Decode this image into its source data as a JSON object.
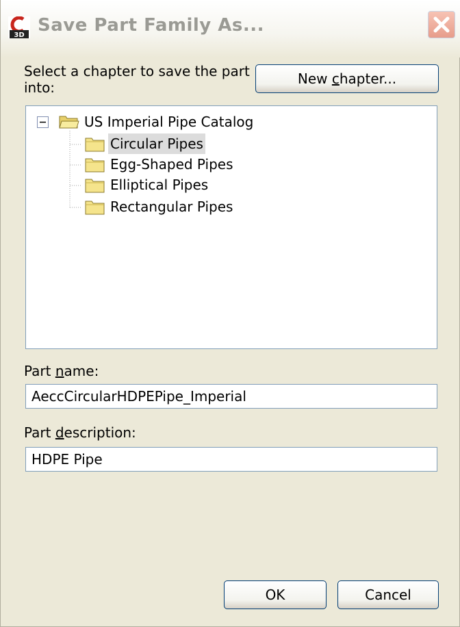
{
  "window": {
    "title": "Save Part Family As..."
  },
  "chapter_section": {
    "prompt": "Select a chapter to save the part into:",
    "new_chapter_button": {
      "before": "New ",
      "mnemonic": "c",
      "after": "hapter..."
    }
  },
  "tree": {
    "root": {
      "label": "US Imperial Pipe Catalog",
      "expanded": true
    },
    "children": [
      {
        "label": "Circular Pipes",
        "selected": true
      },
      {
        "label": "Egg-Shaped Pipes"
      },
      {
        "label": "Elliptical Pipes"
      },
      {
        "label": "Rectangular Pipes"
      }
    ]
  },
  "part_name": {
    "label_before": "Part ",
    "label_mnemonic": "n",
    "label_after": "ame:",
    "value": "AeccCircularHDPEPipe_Imperial"
  },
  "part_description": {
    "label_before": "Part ",
    "label_mnemonic": "d",
    "label_after": "escription:",
    "value": "HDPE Pipe"
  },
  "buttons": {
    "ok": "OK",
    "cancel": "Cancel"
  },
  "colors": {
    "dialog_background": "#ece9d8",
    "folder_fill": "#f5e48c",
    "close_button": "#e79d8b",
    "selection": "#dcdcdc"
  },
  "icons": [
    "civil3d-app-icon",
    "close-icon",
    "collapse-icon",
    "folder-open-icon",
    "folder-icon"
  ]
}
